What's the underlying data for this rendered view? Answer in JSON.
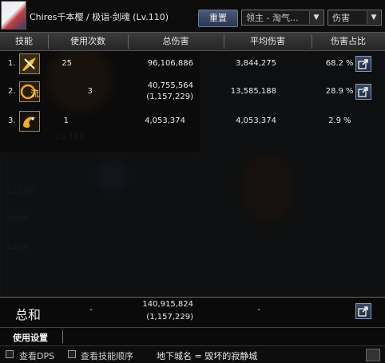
{
  "header": {
    "character_name": "Chires千本樱 / 极诣·剑魂 (Lv.110)",
    "reset_label": "重置",
    "boss_filter": "领主 - 淘气...",
    "metric_select": "伤害"
  },
  "columns": [
    "技能",
    "使用次数",
    "总伤害",
    "平均伤害",
    "伤害占比"
  ],
  "rows": [
    {
      "rank": "1.",
      "uses": "25",
      "total": "96,106,886",
      "total_sub": "",
      "avg": "3,844,275",
      "pct": "68.2",
      "pct_unit": "%",
      "icon": "sword-slash-skill-icon"
    },
    {
      "rank": "2.",
      "uses": "3",
      "total": "40,755,564",
      "total_sub": "(1,157,229)",
      "avg": "13,585,188",
      "pct": "28.9",
      "pct_unit": "%",
      "icon": "flow-sword-skill-icon"
    },
    {
      "rank": "3.",
      "uses": "1",
      "total": "4,053,374",
      "total_sub": "",
      "avg": "4,053,374",
      "pct": "2.9",
      "pct_unit": "%",
      "icon": "golden-dragon-skill-icon"
    }
  ],
  "total": {
    "label": "总和",
    "uses": "-",
    "total": "140,915,824",
    "total_sub": "(1,157,229)",
    "avg": "-"
  },
  "settings_label": "使用设置",
  "footer": {
    "dps_label": "查看DPS",
    "order_label": "查看技能顺序",
    "dungeon": "地下城名 = 毁坏的寂静城"
  },
  "colors": {
    "header_bg": "#333333",
    "button_bg": "#2a3550",
    "text": "#e8e8e8"
  }
}
